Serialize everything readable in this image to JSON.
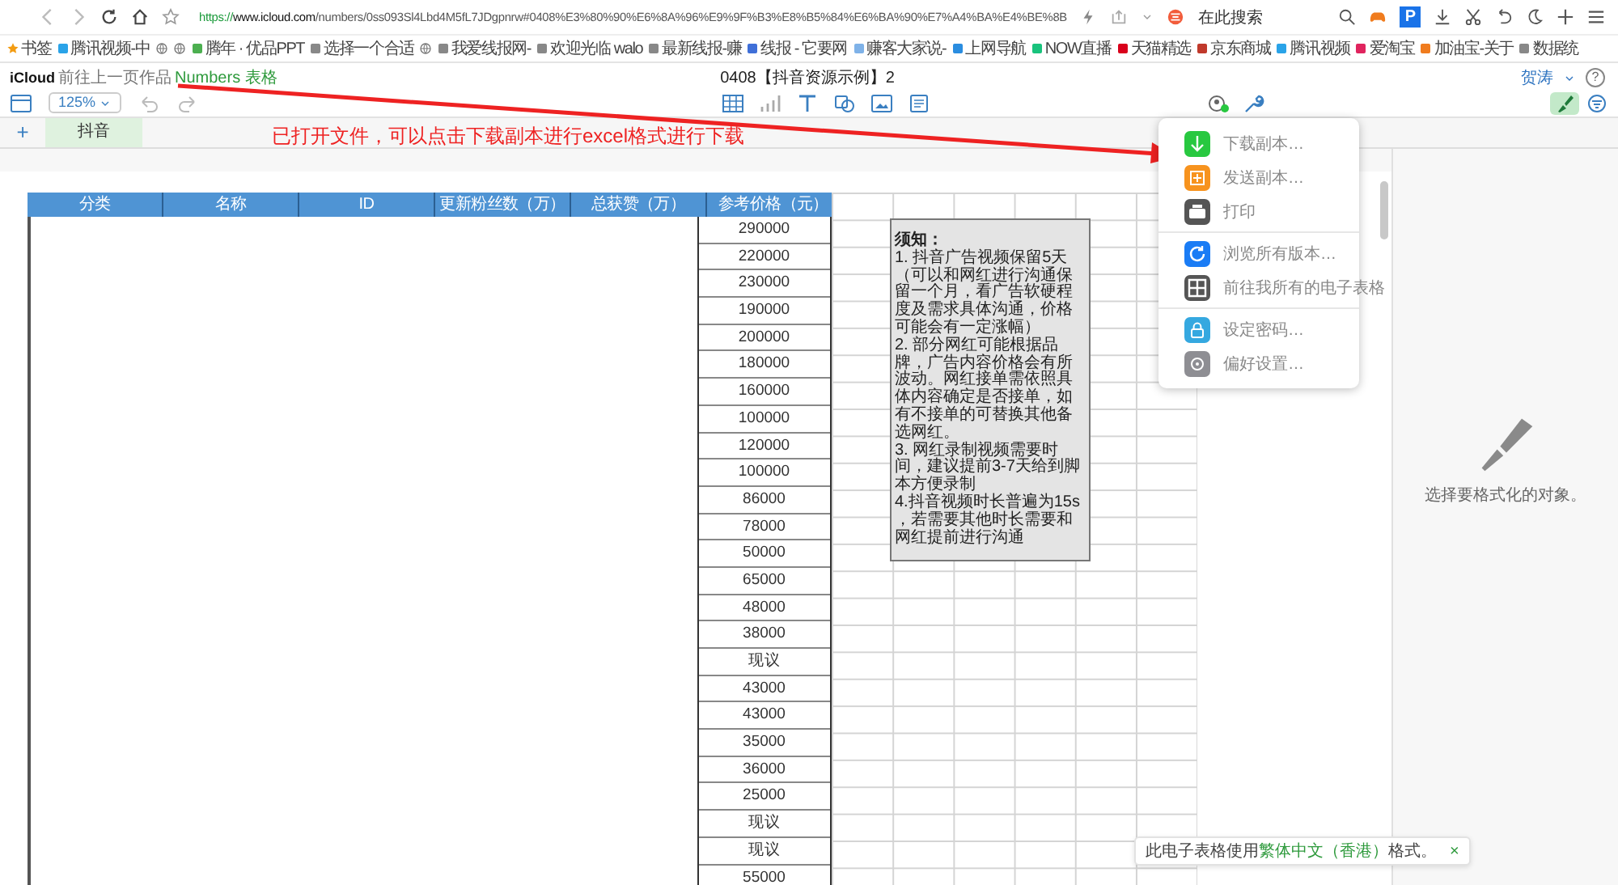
{
  "browser": {
    "url_scheme": "https://",
    "url_host": "www.icloud.com",
    "url_path": "/numbers/0ss093Sl4Lbd4M5fL7JDgpnrw#0408%E3%80%90%E6%8A%96%E9%9F%B3%E8%B5%84%E6%BA%90%E7%A4%BA%E4%BE%8B",
    "search_placeholder": "在此搜索",
    "p_badge": "P"
  },
  "bookmarks": [
    {
      "kind": "star",
      "label": "书签",
      "color": "#f39c12"
    },
    {
      "kind": "link",
      "label": "腾讯视频-中",
      "color": "#2aa3e8"
    },
    {
      "kind": "globe"
    },
    {
      "kind": "globe"
    },
    {
      "kind": "link",
      "label": "腾年 · 优品PPT",
      "color": "#4caf50"
    },
    {
      "kind": "link",
      "label": "选择一个合适",
      "color": "#888888"
    },
    {
      "kind": "globe"
    },
    {
      "kind": "link",
      "label": "我爱线报网-",
      "color": "#888888"
    },
    {
      "kind": "link",
      "label": "欢迎光临 walo",
      "color": "#888888"
    },
    {
      "kind": "link",
      "label": "最新线报-赚",
      "color": "#888888"
    },
    {
      "kind": "link",
      "label": "线报 - 它要网",
      "color": "#3f6fd8"
    },
    {
      "kind": "link",
      "label": "赚客大家说-",
      "color": "#7fb2e8"
    },
    {
      "kind": "link",
      "label": "上网导航",
      "color": "#2a8de0"
    },
    {
      "kind": "link",
      "label": "NOW直播",
      "color": "#19c37d"
    },
    {
      "kind": "link",
      "label": "天猫精选",
      "color": "#d9001b"
    },
    {
      "kind": "link",
      "label": "京东商城",
      "color": "#c0392b"
    },
    {
      "kind": "link",
      "label": "腾讯视频",
      "color": "#2aa3e8"
    },
    {
      "kind": "link",
      "label": "爱淘宝",
      "color": "#e0245e"
    },
    {
      "kind": "link",
      "label": "加油宝-关于",
      "color": "#f07c1e"
    },
    {
      "kind": "link",
      "label": "数据统",
      "color": "#888888"
    }
  ],
  "app": {
    "brand": "iCloud",
    "subtitle": "前往上一页作品",
    "app_name": "Numbers 表格",
    "title": "0408【抖音资源示例】2",
    "user": "贺涛",
    "help": "?",
    "zoom": "125%"
  },
  "sheet_tabs": [
    {
      "label": "抖音",
      "selected": true
    }
  ],
  "add_sheet": "+",
  "annotation": "已打开文件，可以点击下载副本进行excel格式进行下载",
  "table": {
    "columns": [
      "分类",
      "名称",
      "ID",
      "更新粉丝数（万）",
      "总获赞（万）",
      "参考价格（元）"
    ],
    "prices": [
      "290000",
      "220000",
      "230000",
      "190000",
      "200000",
      "180000",
      "160000",
      "100000",
      "120000",
      "100000",
      "86000",
      "78000",
      "50000",
      "65000",
      "48000",
      "38000",
      "现议",
      "43000",
      "43000",
      "35000",
      "36000",
      "25000",
      "现议",
      "现议",
      "55000"
    ]
  },
  "note": "**须知：**\n1. 抖音广告视频保留5天（可以和网红进行沟通保留一个月，看广告软硬程度及需求具体沟通，价格可能会有一定涨幅）\n2. 部分网红可能根据品牌，广告内容价格会有所波动。网红接单需依照具体内容确定是否接单，如有不接单的可替换其他备选网红。\n3. 网红录制视频需要时间，建议提前3-7天给到脚本方便录制\n4.抖音视频时长普遍为15s ，若需要其他时长需要和网红提前进行沟通",
  "menu": {
    "groups": [
      [
        {
          "kind": "download",
          "label": "下载副本…",
          "color": "#28c840"
        },
        {
          "kind": "send",
          "label": "发送副本…",
          "color": "#f7931e"
        },
        {
          "kind": "print",
          "label": "打印",
          "color": "#555555"
        }
      ],
      [
        {
          "kind": "versions",
          "label": "浏览所有版本…",
          "color": "#1a7cf5"
        },
        {
          "kind": "spreadsheets",
          "label": "前往我所有的电子表格",
          "color": "#555555"
        }
      ],
      [
        {
          "kind": "password",
          "label": "设定密码…",
          "color": "#35a8e0"
        },
        {
          "kind": "preferences",
          "label": "偏好设置…",
          "color": "#8e8e93"
        }
      ]
    ]
  },
  "format_panel": {
    "hint": "选择要格式化的对象。"
  },
  "toast": {
    "before": "此电子表格使用",
    "link": "繁体中文（香港）",
    "after": "格式。",
    "close": "×"
  }
}
